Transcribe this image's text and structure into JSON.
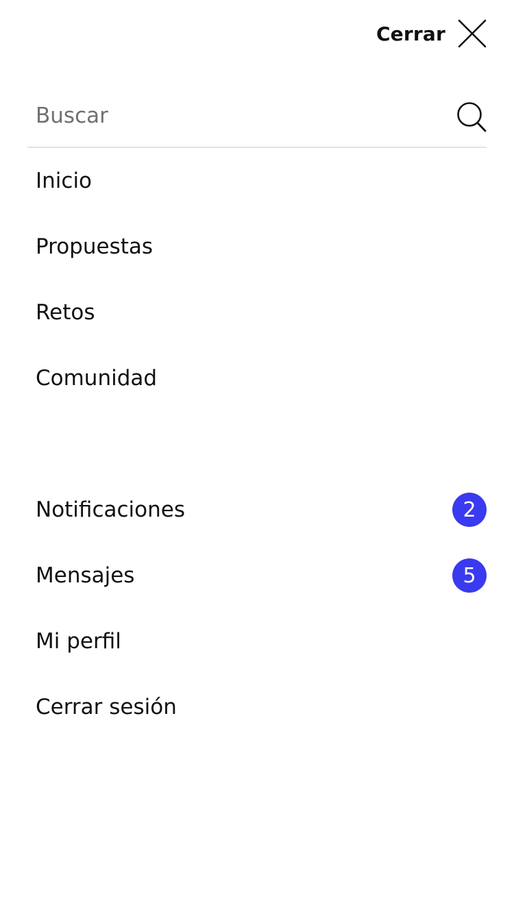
{
  "header": {
    "close_label": "Cerrar",
    "close_icon": "close-icon"
  },
  "search": {
    "placeholder": "Buscar",
    "value": "",
    "icon": "search-icon"
  },
  "primary_nav": {
    "items": [
      {
        "label": "Inicio"
      },
      {
        "label": "Propuestas"
      },
      {
        "label": "Retos"
      },
      {
        "label": "Comunidad"
      }
    ]
  },
  "account_nav": {
    "items": [
      {
        "label": "Notificaciones",
        "badge": "2"
      },
      {
        "label": "Mensajes",
        "badge": "5"
      },
      {
        "label": "Mi perfil"
      },
      {
        "label": "Cerrar sesión"
      }
    ]
  },
  "colors": {
    "badge_background": "#3a3af0",
    "text": "#111111",
    "placeholder": "#707070",
    "divider": "#e3e3e3"
  }
}
